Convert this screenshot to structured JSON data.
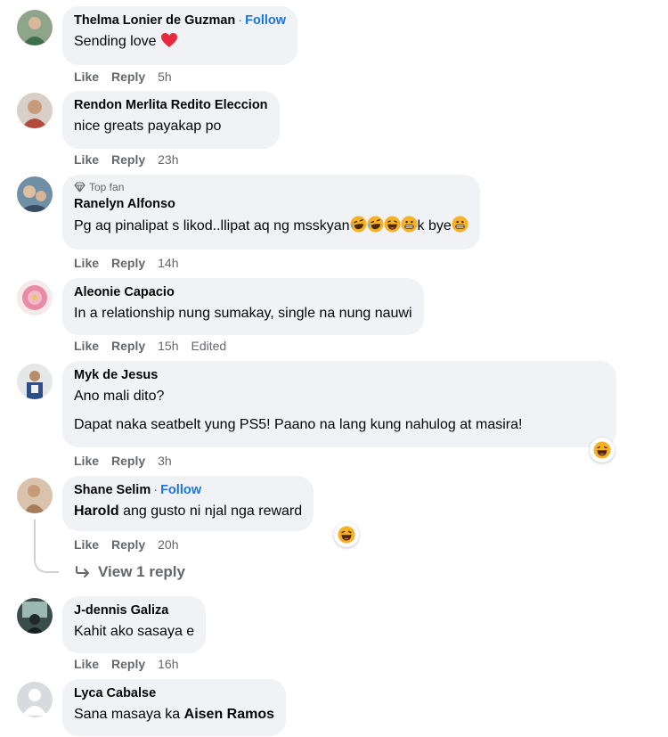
{
  "comments": [
    {
      "author": "Thelma Lonier de Guzman",
      "follow_label": "Follow",
      "text": "Sending love",
      "like_label": "Like",
      "reply_label": "Reply",
      "time": "5h"
    },
    {
      "author": "Rendon Merlita Redito Eleccion",
      "text": "nice greats payakap po",
      "like_label": "Like",
      "reply_label": "Reply",
      "time": "23h"
    },
    {
      "badge": "Top fan",
      "author": "Ranelyn Alfonso",
      "text": "Pg aq pinalipat s likod..llipat aq ng msskyan",
      "text_suffix": "k bye",
      "like_label": "Like",
      "reply_label": "Reply",
      "time": "14h"
    },
    {
      "author": "Aleonie Capacio",
      "text": "In a relationship nung sumakay, single na nung nauwi",
      "like_label": "Like",
      "reply_label": "Reply",
      "time": "15h",
      "edited_label": "Edited"
    },
    {
      "author": "Myk de Jesus",
      "text": "Ano mali dito?",
      "text2": "Dapat naka seatbelt yung PS5! Paano na lang kung nahulog at masira!",
      "like_label": "Like",
      "reply_label": "Reply",
      "time": "3h"
    },
    {
      "author": "Shane Selim",
      "follow_label": "Follow",
      "mention": "Harold",
      "text": "ang gusto ni njal nga reward",
      "like_label": "Like",
      "reply_label": "Reply",
      "time": "20h",
      "view_replies_label": "View 1 reply"
    },
    {
      "author": "J-dennis Galiza",
      "text": "Kahit ako sasaya e",
      "like_label": "Like",
      "reply_label": "Reply",
      "time": "16h"
    },
    {
      "author": "Lyca Cabalse",
      "text": "Sana masaya ka",
      "mention": "Aisen Ramos"
    }
  ],
  "icons": {
    "heart": "red-heart-emoji",
    "haha": "haha-reaction",
    "top_fan": "diamond-icon",
    "reply_arrow": "reply-arrow-icon"
  },
  "colors": {
    "bubble": "#f0f2f5",
    "link": "#1b74e4",
    "secondary": "#65676b",
    "heart": "#e8283c",
    "haha": "#f7b125"
  }
}
